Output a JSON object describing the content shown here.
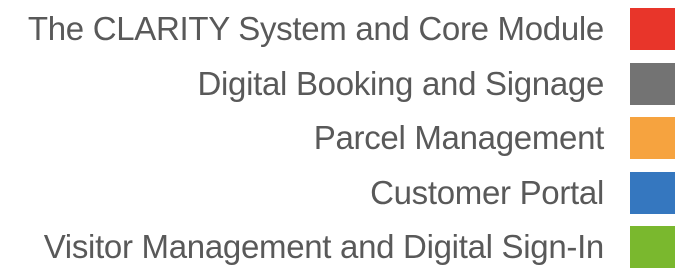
{
  "legend": {
    "items": [
      {
        "label": "The CLARITY System and Core Module",
        "color": "#e8352a"
      },
      {
        "label": "Digital Booking and Signage",
        "color": "#737373"
      },
      {
        "label": "Parcel Management",
        "color": "#f6a33f"
      },
      {
        "label": "Customer Portal",
        "color": "#3577bf"
      },
      {
        "label": "Visitor Management and Digital Sign-In",
        "color": "#7ab82e"
      }
    ]
  }
}
